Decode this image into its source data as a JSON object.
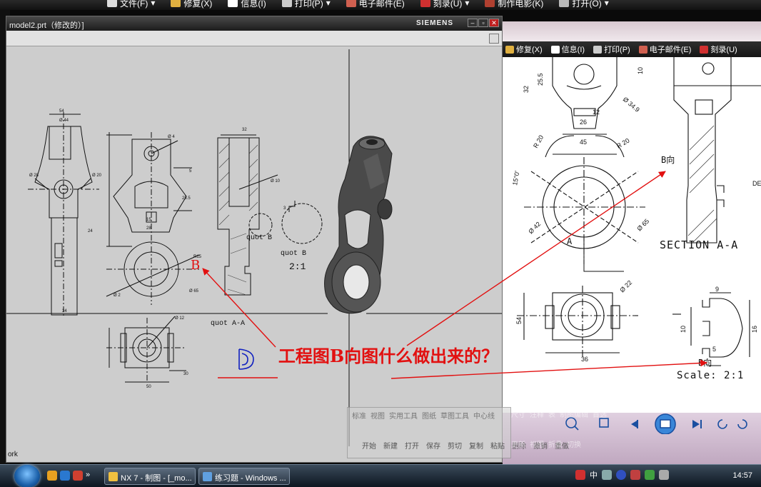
{
  "top_menubar": {
    "items": [
      {
        "label": "文件(F)",
        "icon": "document-icon",
        "dropdown": true
      },
      {
        "label": "修复(X)",
        "icon": "repair-icon",
        "dropdown": false
      },
      {
        "label": "信息(I)",
        "icon": "tag-icon",
        "dropdown": false
      },
      {
        "label": "打印(P)",
        "icon": "printer-icon",
        "dropdown": true
      },
      {
        "label": "电子邮件(E)",
        "icon": "email-icon",
        "dropdown": false
      },
      {
        "label": "刻录(U)",
        "icon": "burn-disc-icon",
        "dropdown": true
      },
      {
        "label": "制作电影(K)",
        "icon": "film-icon",
        "dropdown": false
      },
      {
        "label": "打开(O)",
        "icon": "open-icon",
        "dropdown": true
      }
    ]
  },
  "nx_window": {
    "title": "model2.prt（修改的）]",
    "brand": "SIEMENS",
    "status_text": "ork",
    "drawing": {
      "view_label_section": "quot A-A",
      "view_label_detail_b": "quot B",
      "view_label_detail_b_right": "quot B",
      "detail_scale": "2:1",
      "dims": [
        "54",
        "Ø 44",
        "Ø 28",
        "Ø 20",
        "Ø 4",
        "5",
        "15",
        "28",
        "Ø 10",
        "R15",
        "Ø 2",
        "Ø 65",
        "Ø 12",
        "24",
        "34",
        "50",
        "30",
        "25.5",
        "32",
        "3"
      ]
    }
  },
  "viewer": {
    "menubar": [
      {
        "label": "修复(X)",
        "icon": "repair-icon"
      },
      {
        "label": "信息(I)",
        "icon": "tag-icon"
      },
      {
        "label": "打印(P)",
        "icon": "printer-icon"
      },
      {
        "label": "电子邮件(E)",
        "icon": "email-icon"
      },
      {
        "label": "刻录(U)",
        "icon": "burn-disc-icon"
      }
    ],
    "drawing": {
      "section_title": "SECTION A-A",
      "b_label_top": "B向",
      "b_label_bottom": "B向",
      "scale_text": "Scale: 2:1",
      "cut_label": "A",
      "dims": [
        "32",
        "25.5",
        "10",
        "12",
        "26",
        "45",
        "R 20",
        "R 20",
        "Ø 34.9",
        "15°0'",
        "Ø 42",
        "Ø 65",
        "Ø 22",
        "54",
        "36",
        "9",
        "10",
        "16",
        "5",
        "DE"
      ]
    }
  },
  "overlay_toolbar": {
    "tabs": [
      "标准",
      "视图",
      "实用工具",
      "图纸",
      "草图工具",
      "中心线",
      "尺寸",
      "注释",
      "表",
      "制图编辑",
      "首选"
    ],
    "buttons": [
      "开始",
      "新建",
      "打开",
      "保存",
      "剪切",
      "复制",
      "粘贴",
      "删除",
      "撤销",
      "重做",
      "更新",
      "视图",
      "折叠",
      "切换"
    ]
  },
  "annotation": {
    "question": "工程图B向图什么做出来的？",
    "b_label": "B",
    "color": "#e21010"
  },
  "taskbar": {
    "tasks": [
      {
        "label": "NX 7 - 制图 - [_mo...",
        "icon": "nx-app-icon"
      },
      {
        "label": "练习题 - Windows ...",
        "icon": "photo-viewer-icon"
      }
    ],
    "tray": {
      "ime": "中",
      "clock": "14:57"
    },
    "quicklaunch_more": "»"
  }
}
